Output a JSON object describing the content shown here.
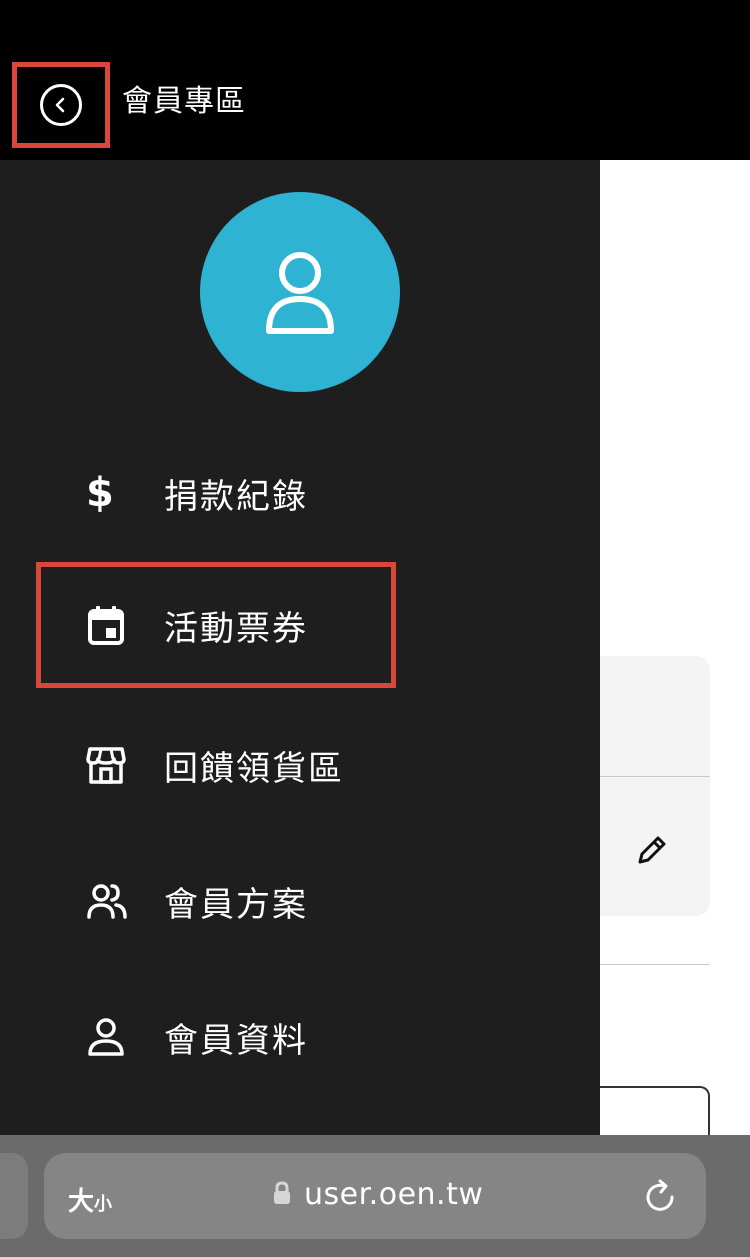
{
  "header": {
    "title": "會員專區"
  },
  "drawer": {
    "menu": [
      {
        "label": "捐款紀錄",
        "icon": "dollar-icon"
      },
      {
        "label": "活動票券",
        "icon": "calendar-icon"
      },
      {
        "label": "回饋領貨區",
        "icon": "store-icon"
      },
      {
        "label": "會員方案",
        "icon": "users-icon"
      },
      {
        "label": "會員資料",
        "icon": "user-icon"
      }
    ]
  },
  "browser": {
    "text_size_label_big": "大",
    "text_size_label_small": "小",
    "url": "user.oen.tw"
  },
  "colors": {
    "accent": "#2fb3d3",
    "highlight": "#d9473c",
    "drawer_bg": "#1e1e1e",
    "header_bg": "#000000"
  }
}
